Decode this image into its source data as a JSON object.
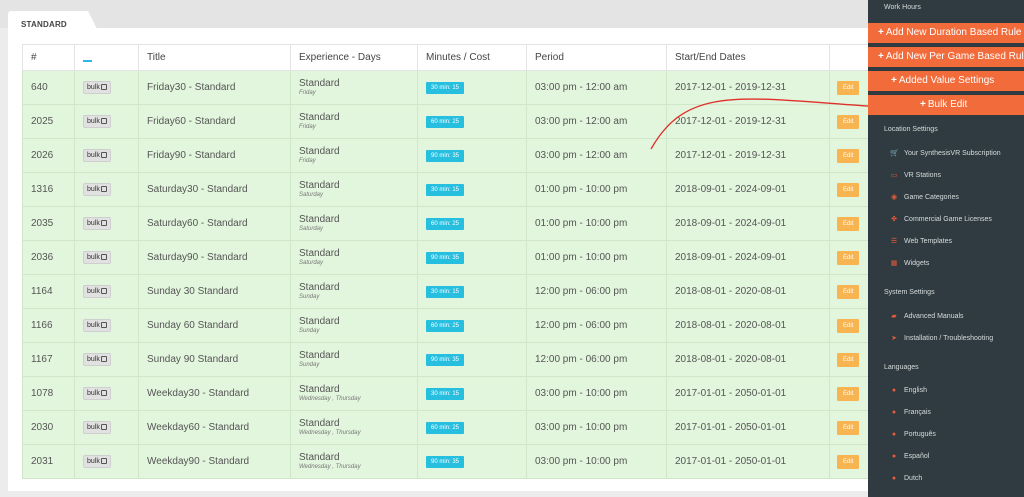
{
  "tab": {
    "label": "STANDARD"
  },
  "table": {
    "headers": {
      "id": "#",
      "title": "Title",
      "experience": "Experience - Days",
      "minutes_cost": "Minutes / Cost",
      "period": "Period",
      "dates": "Start/End Dates"
    },
    "bulk_label": "bulk",
    "edit_label": "Edit",
    "rows": [
      {
        "id": "640",
        "title": "Friday30 - Standard",
        "exp": "Standard",
        "days": "Friday",
        "cost": "30 min: 15",
        "period": "03:00 pm - 12:00 am",
        "dates": "2017-12-01 - 2019-12-31"
      },
      {
        "id": "2025",
        "title": "Friday60 - Standard",
        "exp": "Standard",
        "days": "Friday",
        "cost": "60 min: 25",
        "period": "03:00 pm - 12:00 am",
        "dates": "2017-12-01 - 2019-12-31"
      },
      {
        "id": "2026",
        "title": "Friday90 - Standard",
        "exp": "Standard",
        "days": "Friday",
        "cost": "90 min: 35",
        "period": "03:00 pm - 12:00 am",
        "dates": "2017-12-01 - 2019-12-31"
      },
      {
        "id": "1316",
        "title": "Saturday30 - Standard",
        "exp": "Standard",
        "days": "Saturday",
        "cost": "30 min: 15",
        "period": "01:00 pm - 10:00 pm",
        "dates": "2018-09-01 - 2024-09-01"
      },
      {
        "id": "2035",
        "title": "Saturday60 - Standard",
        "exp": "Standard",
        "days": "Saturday",
        "cost": "60 min: 25",
        "period": "01:00 pm - 10:00 pm",
        "dates": "2018-09-01 - 2024-09-01"
      },
      {
        "id": "2036",
        "title": "Saturday90 - Standard",
        "exp": "Standard",
        "days": "Saturday",
        "cost": "90 min: 35",
        "period": "01:00 pm - 10:00 pm",
        "dates": "2018-09-01 - 2024-09-01"
      },
      {
        "id": "1164",
        "title": "Sunday 30 Standard",
        "exp": "Standard",
        "days": "Sunday",
        "cost": "30 min: 15",
        "period": "12:00 pm - 06:00 pm",
        "dates": "2018-08-01 - 2020-08-01"
      },
      {
        "id": "1166",
        "title": "Sunday 60 Standard",
        "exp": "Standard",
        "days": "Sunday",
        "cost": "60 min: 25",
        "period": "12:00 pm - 06:00 pm",
        "dates": "2018-08-01 - 2020-08-01"
      },
      {
        "id": "1167",
        "title": "Sunday 90 Standard",
        "exp": "Standard",
        "days": "Sunday",
        "cost": "90 min: 35",
        "period": "12:00 pm - 06:00 pm",
        "dates": "2018-08-01 - 2020-08-01"
      },
      {
        "id": "1078",
        "title": "Weekday30 - Standard",
        "exp": "Standard",
        "days": "Wednesday , Thursday",
        "cost": "30 min: 15",
        "period": "03:00 pm - 10:00 pm",
        "dates": "2017-01-01 - 2050-01-01"
      },
      {
        "id": "2030",
        "title": "Weekday60 - Standard",
        "exp": "Standard",
        "days": "Wednesday , Thursday",
        "cost": "60 min: 25",
        "period": "03:00 pm - 10:00 pm",
        "dates": "2017-01-01 - 2050-01-01"
      },
      {
        "id": "2031",
        "title": "Weekday90 - Standard",
        "exp": "Standard",
        "days": "Wednesday , Thursday",
        "cost": "90 min: 35",
        "period": "03:00 pm - 10:00 pm",
        "dates": "2017-01-01 - 2050-01-01"
      }
    ]
  },
  "sidebar": {
    "work_hours": "Work Hours",
    "actions": [
      {
        "label": "Add New Duration Based Rule",
        "icon": "plus-icon"
      },
      {
        "label": "Add New Per Game Based Rule",
        "icon": "plus-icon"
      },
      {
        "label": "Added Value Settings",
        "icon": "plus-icon"
      },
      {
        "label": "Bulk Edit",
        "icon": "plus-icon"
      }
    ],
    "location_settings": "Location Settings",
    "location_items": [
      {
        "label": "Your SynthesisVR Subscription",
        "icon": "cart-icon"
      },
      {
        "label": "VR Stations",
        "icon": "monitor-icon"
      },
      {
        "label": "Game Categories",
        "icon": "gamepad-icon"
      },
      {
        "label": "Commercial Game Licenses",
        "icon": "puzzle-icon"
      },
      {
        "label": "Web Templates",
        "icon": "list-icon"
      },
      {
        "label": "Widgets",
        "icon": "grid-icon"
      }
    ],
    "system_settings": "System Settings",
    "system_items": [
      {
        "label": "Advanced Manuals",
        "icon": "folder-icon"
      },
      {
        "label": "Installation / Troubleshooting",
        "icon": "paper-plane-icon"
      }
    ],
    "languages": "Languages",
    "language_items": [
      {
        "label": "English",
        "icon": "globe-icon"
      },
      {
        "label": "Français",
        "icon": "globe-icon"
      },
      {
        "label": "Português",
        "icon": "globe-icon"
      },
      {
        "label": "Español",
        "icon": "globe-icon"
      },
      {
        "label": "Dutch",
        "icon": "globe-icon"
      }
    ]
  },
  "colors": {
    "row_bg": "#e2f5dd",
    "cost_badge": "#27bfe0",
    "edit_button": "#f7b451",
    "sidebar_bg": "#2f3b40",
    "action_button": "#f26b3a",
    "annotation_arrow": "#e0302a"
  }
}
